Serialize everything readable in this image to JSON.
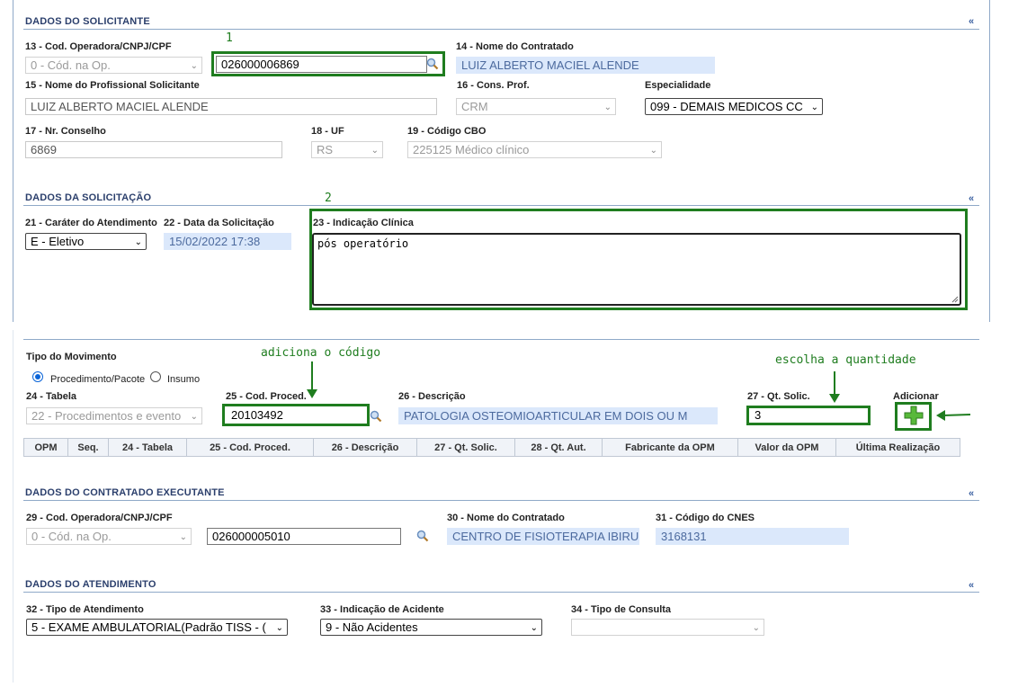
{
  "collapse_glyph": "«",
  "solicitante": {
    "title": "DADOS DO SOLICITANTE",
    "cod_operadora_label": "13 - Cod. Operadora/CNPJ/CPF",
    "cod_operadora_select": "0 - Cód. na Op.",
    "cod_operadora_value": "026000006869",
    "nome_contratado_label": "14 - Nome do Contratado",
    "nome_contratado_value": "LUIZ ALBERTO MACIEL ALENDE",
    "nome_profissional_label": "15 - Nome do Profissional Solicitante",
    "nome_profissional_value": "LUIZ ALBERTO MACIEL ALENDE",
    "cons_prof_label": "16 - Cons. Prof.",
    "cons_prof_value": "CRM",
    "especialidade_label": "Especialidade",
    "especialidade_value": "099 - DEMAIS MEDICOS CC",
    "nr_conselho_label": "17 - Nr. Conselho",
    "nr_conselho_value": "6869",
    "uf_label": "18 - UF",
    "uf_value": "RS",
    "cbo_label": "19 - Código CBO",
    "cbo_value": "225125 Médico clínico"
  },
  "solicitacao": {
    "title": "DADOS DA SOLICITAÇÃO",
    "carater_label": "21 - Caráter do Atendimento",
    "carater_value": "E - Eletivo",
    "data_label": "22 - Data da Solicitação",
    "data_value": "15/02/2022 17:38",
    "indicacao_label": "23 - Indicação Clínica",
    "indicacao_value": "pós operatório"
  },
  "procedimento": {
    "tipo_movimento_label": "Tipo do Movimento",
    "radio_procedimento": "Procedimento/Pacote",
    "radio_insumo": "Insumo",
    "tabela_label": "24 - Tabela",
    "tabela_value": "22 - Procedimentos e evento",
    "cod_proced_label": "25 - Cod. Proced.",
    "cod_proced_value": "20103492",
    "descricao_label": "26 - Descrição",
    "descricao_value": "PATOLOGIA OSTEOMIOARTICULAR EM DOIS OU M",
    "qt_solic_label": "27 - Qt. Solic.",
    "qt_solic_value": "3",
    "adicionar_label": "Adicionar",
    "columns": [
      "OPM",
      "Seq.",
      "24 - Tabela",
      "25 - Cod. Proced.",
      "26 - Descrição",
      "27 - Qt. Solic.",
      "28 - Qt. Aut.",
      "Fabricante da OPM",
      "Valor da OPM",
      "Última Realização"
    ]
  },
  "executante": {
    "title": "DADOS DO CONTRATADO EXECUTANTE",
    "cod_operadora_label": "29 - Cod. Operadora/CNPJ/CPF",
    "cod_operadora_select": "0 - Cód. na Op.",
    "cod_operadora_value": "026000005010",
    "nome_label": "30 - Nome do Contratado",
    "nome_value": "CENTRO DE FISIOTERAPIA IBIRU",
    "cnes_label": "31 - Código do CNES",
    "cnes_value": "3168131"
  },
  "atendimento": {
    "title": "DADOS DO ATENDIMENTO",
    "tipo_label": "32 - Tipo de Atendimento",
    "tipo_value": "5 - EXAME AMBULATORIAL(Padrão TISS - (",
    "acidente_label": "33 - Indicação de Acidente",
    "acidente_value": "9 - Não Acidentes",
    "consulta_label": "34 - Tipo de Consulta",
    "consulta_value": ""
  },
  "annotations": {
    "step1": "1",
    "step2": "2",
    "adiciona_codigo": "adiciona o código",
    "escolha_quantidade": "escolha a quantidade"
  },
  "colors": {
    "annotation_green": "#1f7d1f",
    "section_title": "#2b3f6c",
    "readonly_bg": "#dbe8fb"
  }
}
